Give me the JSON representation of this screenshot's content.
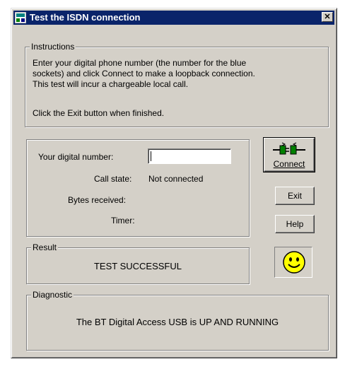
{
  "window": {
    "title": "Test the ISDN connection",
    "close_glyph": "✕"
  },
  "instructions": {
    "legend": "Instructions",
    "line1": "Enter your digital phone number (the number for the blue",
    "line2": "sockets) and click Connect to make a loopback connection.",
    "line3": "This test will incur a chargeable local call.",
    "line4": "Click the Exit button when finished."
  },
  "form": {
    "number_label": "Your digital number:",
    "number_value": "",
    "call_state_label": "Call state:",
    "call_state_value": "Not connected",
    "bytes_label": "Bytes received:",
    "bytes_value": "",
    "timer_label": "Timer:",
    "timer_value": ""
  },
  "buttons": {
    "connect": "Connect",
    "exit": "Exit",
    "help": "Help"
  },
  "result": {
    "legend": "Result",
    "text": "TEST SUCCESSFUL"
  },
  "diagnostic": {
    "legend": "Diagnostic",
    "text": "The BT Digital Access USB is UP AND RUNNING"
  },
  "icons": {
    "connect": "plug-connect-icon",
    "status": "smiley-face-icon",
    "app": "isdn-app-icon"
  },
  "colors": {
    "titlebar": "#0a246a",
    "face": "#d4d0c8",
    "smiley": "#ffff00",
    "plug": "#008000"
  }
}
